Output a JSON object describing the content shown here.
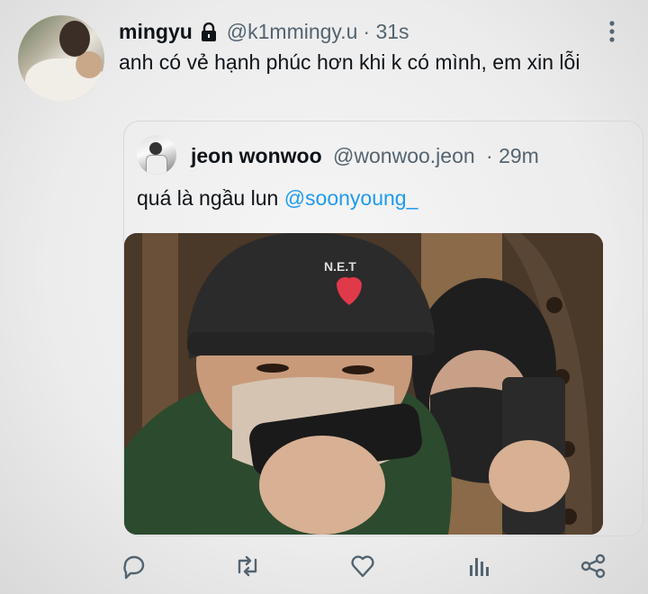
{
  "tweet": {
    "display_name": "mingyu",
    "handle": "@k1mmingy.u",
    "time": "· 31s",
    "text": "anh có vẻ hạnh phúc hơn khi k có mình, em xin lỗi"
  },
  "quoted_tweet": {
    "display_name": "jeon wonwoo",
    "handle": "@wonwoo.jeon",
    "time": "· 29m",
    "text": "quá là ngầu lun",
    "mention": "@soonyoung_",
    "media": "photo"
  },
  "actions": [
    "reply-icon",
    "retweet-icon",
    "like-icon",
    "views-icon",
    "share-icon"
  ],
  "colors": {
    "text": "#0f1419",
    "secondary": "#536471",
    "link": "#1d9bf0",
    "border": "#d4d8dc"
  }
}
